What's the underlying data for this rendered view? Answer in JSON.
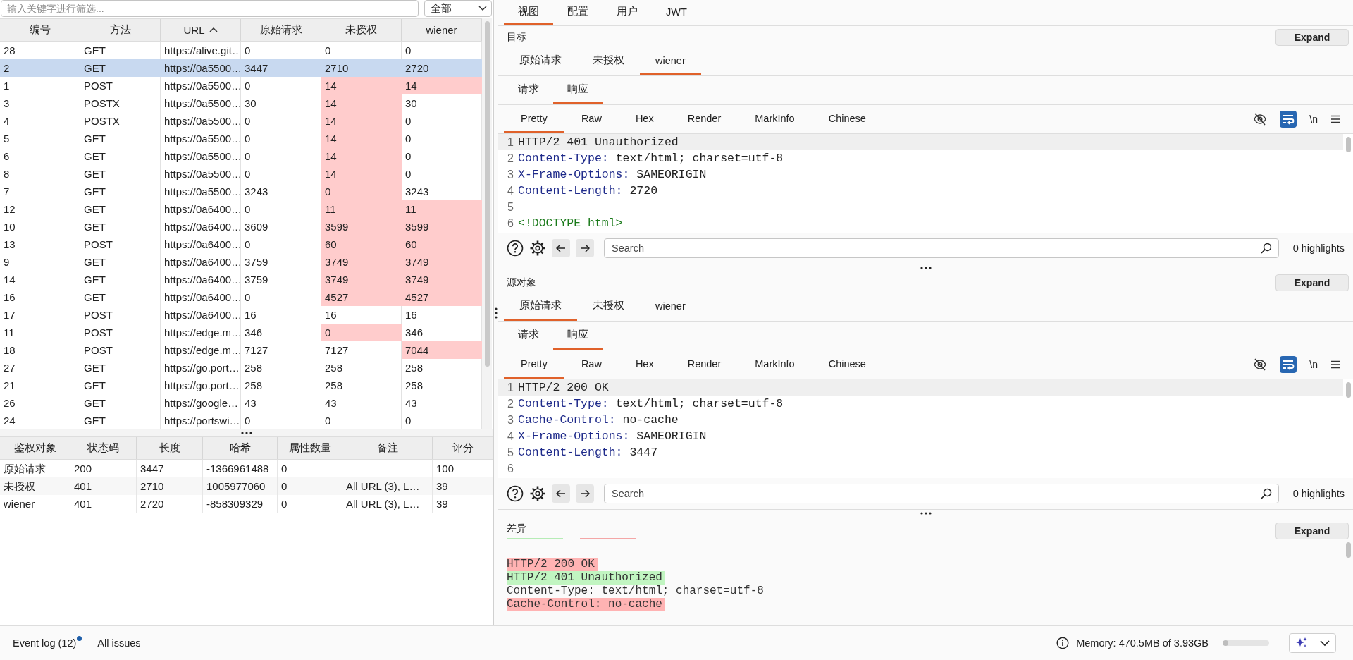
{
  "filter": {
    "placeholder": "输入关键字进行筛选...",
    "scope": "全部"
  },
  "requests_table": {
    "columns": [
      {
        "label": "编号",
        "sorted": false
      },
      {
        "label": "方法",
        "sorted": false
      },
      {
        "label": "URL",
        "sorted": true
      },
      {
        "label": "原始请求",
        "sorted": false
      },
      {
        "label": "未授权",
        "sorted": false
      },
      {
        "label": "wiener",
        "sorted": false
      }
    ],
    "rows": [
      {
        "cells": [
          "28",
          "GET",
          "https://alive.git…",
          "0",
          "0",
          "0"
        ],
        "flagged": [
          false,
          false,
          false,
          false,
          false,
          false
        ],
        "selected": false
      },
      {
        "cells": [
          "2",
          "GET",
          "https://0a5500…",
          "3447",
          "2710",
          "2720"
        ],
        "selected": true
      },
      {
        "cells": [
          "1",
          "POST",
          "https://0a5500…",
          "0",
          "14",
          "14"
        ],
        "flagged": [
          false,
          false,
          false,
          false,
          true,
          true
        ],
        "selected": false
      },
      {
        "cells": [
          "3",
          "POSTX",
          "https://0a5500…",
          "30",
          "14",
          "30"
        ],
        "flagged": [
          false,
          false,
          false,
          false,
          true,
          false
        ],
        "selected": false
      },
      {
        "cells": [
          "4",
          "POSTX",
          "https://0a5500…",
          "0",
          "14",
          "0"
        ],
        "flagged": [
          false,
          false,
          false,
          false,
          true,
          false
        ],
        "selected": false
      },
      {
        "cells": [
          "5",
          "GET",
          "https://0a5500…",
          "0",
          "14",
          "0"
        ],
        "flagged": [
          false,
          false,
          false,
          false,
          true,
          false
        ],
        "selected": false
      },
      {
        "cells": [
          "6",
          "GET",
          "https://0a5500…",
          "0",
          "14",
          "0"
        ],
        "flagged": [
          false,
          false,
          false,
          false,
          true,
          false
        ],
        "selected": false
      },
      {
        "cells": [
          "8",
          "GET",
          "https://0a5500…",
          "0",
          "14",
          "0"
        ],
        "flagged": [
          false,
          false,
          false,
          false,
          true,
          false
        ],
        "selected": false
      },
      {
        "cells": [
          "7",
          "GET",
          "https://0a5500…",
          "3243",
          "0",
          "3243"
        ],
        "flagged": [
          false,
          false,
          false,
          false,
          true,
          false
        ],
        "selected": false
      },
      {
        "cells": [
          "12",
          "GET",
          "https://0a6400…",
          "0",
          "11",
          "11"
        ],
        "flagged": [
          false,
          false,
          false,
          false,
          true,
          true
        ],
        "selected": false
      },
      {
        "cells": [
          "10",
          "GET",
          "https://0a6400…",
          "3609",
          "3599",
          "3599"
        ],
        "flagged": [
          false,
          false,
          false,
          false,
          true,
          true
        ],
        "selected": false
      },
      {
        "cells": [
          "13",
          "POST",
          "https://0a6400…",
          "0",
          "60",
          "60"
        ],
        "flagged": [
          false,
          false,
          false,
          false,
          true,
          true
        ],
        "selected": false
      },
      {
        "cells": [
          "9",
          "GET",
          "https://0a6400…",
          "3759",
          "3749",
          "3749"
        ],
        "flagged": [
          false,
          false,
          false,
          false,
          true,
          true
        ],
        "selected": false
      },
      {
        "cells": [
          "14",
          "GET",
          "https://0a6400…",
          "3759",
          "3749",
          "3749"
        ],
        "flagged": [
          false,
          false,
          false,
          false,
          true,
          true
        ],
        "selected": false
      },
      {
        "cells": [
          "16",
          "GET",
          "https://0a6400…",
          "0",
          "4527",
          "4527"
        ],
        "flagged": [
          false,
          false,
          false,
          false,
          true,
          true
        ],
        "selected": false
      },
      {
        "cells": [
          "17",
          "POST",
          "https://0a6400…",
          "16",
          "16",
          "16"
        ],
        "flagged": [
          false,
          false,
          false,
          false,
          false,
          false
        ],
        "selected": false
      },
      {
        "cells": [
          "11",
          "POST",
          "https://edge.m…",
          "346",
          "0",
          "346"
        ],
        "flagged": [
          false,
          false,
          false,
          false,
          true,
          false
        ],
        "selected": false
      },
      {
        "cells": [
          "18",
          "POST",
          "https://edge.m…",
          "7127",
          "7127",
          "7044"
        ],
        "flagged": [
          false,
          false,
          false,
          false,
          false,
          true
        ],
        "selected": false
      },
      {
        "cells": [
          "27",
          "GET",
          "https://go.port…",
          "258",
          "258",
          "258"
        ],
        "flagged": [
          false,
          false,
          false,
          false,
          false,
          false
        ],
        "selected": false
      },
      {
        "cells": [
          "21",
          "GET",
          "https://go.port…",
          "258",
          "258",
          "258"
        ],
        "flagged": [
          false,
          false,
          false,
          false,
          false,
          false
        ],
        "selected": false
      },
      {
        "cells": [
          "26",
          "GET",
          "https://google…",
          "43",
          "43",
          "43"
        ],
        "flagged": [
          false,
          false,
          false,
          false,
          false,
          false
        ],
        "selected": false
      },
      {
        "cells": [
          "24",
          "GET",
          "https://portswi…",
          "0",
          "0",
          "0"
        ],
        "flagged": [
          false,
          false,
          false,
          false,
          false,
          false
        ],
        "selected": false
      }
    ]
  },
  "results_table": {
    "columns": [
      "鉴权对象",
      "状态码",
      "长度",
      "哈希",
      "属性数量",
      "备注",
      "评分"
    ],
    "rows": [
      [
        "原始请求",
        "200",
        "3447",
        "-1366961488",
        "0",
        null,
        "100"
      ],
      [
        "未授权",
        "401",
        "2710",
        "1005977060",
        "0",
        "All URL (3), L…",
        "39"
      ],
      [
        "wiener",
        "401",
        "2720",
        "-858309329",
        "0",
        "All URL (3), L…",
        "39"
      ]
    ]
  },
  "view_tabs": [
    {
      "label": "视图",
      "selected": true
    },
    {
      "label": "配置",
      "selected": false
    },
    {
      "label": "用户",
      "selected": false
    },
    {
      "label": "JWT",
      "selected": false
    }
  ],
  "panels": [
    {
      "title": "目标",
      "expand": "Expand",
      "targets": [
        {
          "label": "原始请求",
          "selected": false
        },
        {
          "label": "未授权",
          "selected": false
        },
        {
          "label": "wiener",
          "selected": true
        }
      ],
      "message_tabs": [
        {
          "label": "请求",
          "selected": false
        },
        {
          "label": "响应",
          "selected": true
        }
      ],
      "view_modes": [
        {
          "label": "Pretty",
          "selected": true
        },
        {
          "label": "Raw",
          "selected": false
        },
        {
          "label": "Hex",
          "selected": false
        },
        {
          "label": "Render",
          "selected": false
        },
        {
          "label": "MarkInfo",
          "selected": false
        },
        {
          "label": "Chinese",
          "selected": false
        }
      ],
      "word_wrap": true,
      "newline_toggle": "\\n",
      "lines": [
        {
          "no": "1",
          "kind": "status",
          "text": "HTTP/2 401 Unauthorized"
        },
        {
          "no": "2",
          "kind": "header",
          "name": "Content-Type:",
          "value": "text/html; charset=utf-8"
        },
        {
          "no": "3",
          "kind": "header",
          "name": "X-Frame-Options:",
          "value": "SAMEORIGIN"
        },
        {
          "no": "4",
          "kind": "header",
          "name": "Content-Length:",
          "value": "2720"
        },
        {
          "no": "5",
          "kind": "blank"
        },
        {
          "no": "6",
          "kind": "markup",
          "text": "<!DOCTYPE html>"
        }
      ],
      "search": {
        "placeholder": "Search"
      },
      "highlights": "0 highlights"
    },
    {
      "title": "源对象",
      "expand": "Expand",
      "targets": [
        {
          "label": "原始请求",
          "selected": true
        },
        {
          "label": "未授权",
          "selected": false
        },
        {
          "label": "wiener",
          "selected": false
        }
      ],
      "message_tabs": [
        {
          "label": "请求",
          "selected": false
        },
        {
          "label": "响应",
          "selected": true
        }
      ],
      "view_modes": [
        {
          "label": "Pretty",
          "selected": true
        },
        {
          "label": "Raw",
          "selected": false
        },
        {
          "label": "Hex",
          "selected": false
        },
        {
          "label": "Render",
          "selected": false
        },
        {
          "label": "MarkInfo",
          "selected": false
        },
        {
          "label": "Chinese",
          "selected": false
        }
      ],
      "word_wrap": true,
      "newline_toggle": "\\n",
      "lines": [
        {
          "no": "1",
          "kind": "status",
          "text": "HTTP/2 200 OK"
        },
        {
          "no": "2",
          "kind": "header",
          "name": "Content-Type:",
          "value": "text/html; charset=utf-8"
        },
        {
          "no": "3",
          "kind": "header",
          "name": "Cache-Control:",
          "value": "no-cache"
        },
        {
          "no": "4",
          "kind": "header",
          "name": "X-Frame-Options:",
          "value": "SAMEORIGIN"
        },
        {
          "no": "5",
          "kind": "header",
          "name": "Content-Length:",
          "value": "3447"
        },
        {
          "no": "6",
          "kind": "blank"
        }
      ],
      "search": {
        "placeholder": "Search"
      },
      "highlights": "0 highlights"
    }
  ],
  "diff": {
    "title": "差异",
    "expand": "Expand",
    "lines": [
      {
        "kind": "removed",
        "text": "HTTP/2 200 OK"
      },
      {
        "kind": "added",
        "text": "HTTP/2 401 Unauthorized"
      },
      {
        "kind": "same",
        "text": "Content-Type: text/html; charset=utf-8"
      },
      {
        "kind": "removed",
        "text": "Cache-Control: no-cache"
      }
    ]
  },
  "status_bar": {
    "event_log": {
      "label": "Event log (12)",
      "unread": true
    },
    "issues": "All issues",
    "memory": {
      "text": "Memory: 470.5MB of 3.93GB",
      "level": 0.12
    }
  }
}
